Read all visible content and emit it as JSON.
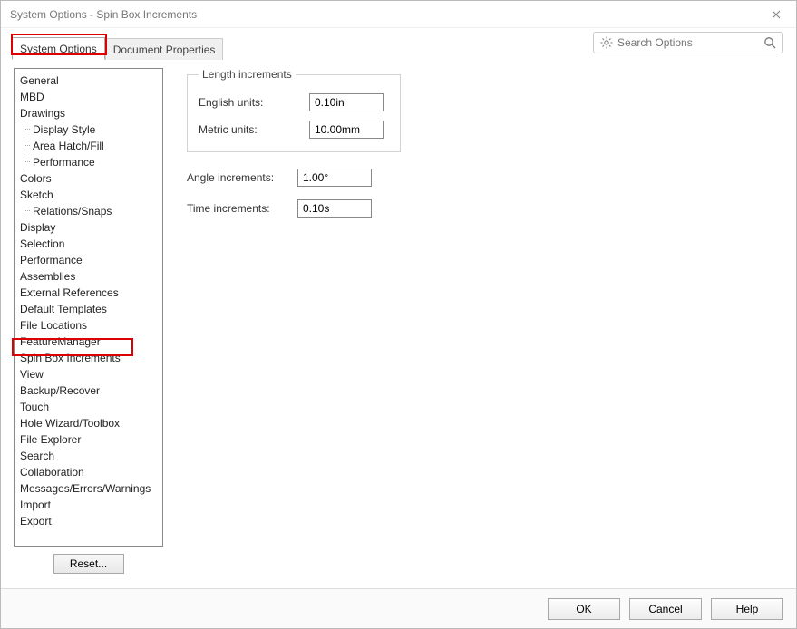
{
  "window": {
    "title": "System Options - Spin Box Increments"
  },
  "tabs": {
    "system_options": "System Options",
    "document_properties": "Document Properties"
  },
  "search": {
    "placeholder": "Search Options"
  },
  "tree": {
    "items": [
      {
        "label": "General"
      },
      {
        "label": "MBD"
      },
      {
        "label": "Drawings"
      },
      {
        "label": "Display Style",
        "child": true
      },
      {
        "label": "Area Hatch/Fill",
        "child": true
      },
      {
        "label": "Performance",
        "child": true
      },
      {
        "label": "Colors"
      },
      {
        "label": "Sketch"
      },
      {
        "label": "Relations/Snaps",
        "child": true
      },
      {
        "label": "Display"
      },
      {
        "label": "Selection"
      },
      {
        "label": "Performance"
      },
      {
        "label": "Assemblies"
      },
      {
        "label": "External References"
      },
      {
        "label": "Default Templates"
      },
      {
        "label": "File Locations"
      },
      {
        "label": "FeatureManager"
      },
      {
        "label": "Spin Box Increments"
      },
      {
        "label": "View"
      },
      {
        "label": "Backup/Recover"
      },
      {
        "label": "Touch"
      },
      {
        "label": "Hole Wizard/Toolbox"
      },
      {
        "label": "File Explorer"
      },
      {
        "label": "Search"
      },
      {
        "label": "Collaboration"
      },
      {
        "label": "Messages/Errors/Warnings"
      },
      {
        "label": "Import"
      },
      {
        "label": "Export"
      }
    ]
  },
  "reset": {
    "label": "Reset..."
  },
  "panel": {
    "length_legend": "Length increments",
    "english_label": "English units:",
    "english_value": "0.10in",
    "metric_label": "Metric units:",
    "metric_value": "10.00mm",
    "angle_label": "Angle increments:",
    "angle_value": "1.00°",
    "time_label": "Time increments:",
    "time_value": "0.10s"
  },
  "footer": {
    "ok": "OK",
    "cancel": "Cancel",
    "help": "Help"
  }
}
